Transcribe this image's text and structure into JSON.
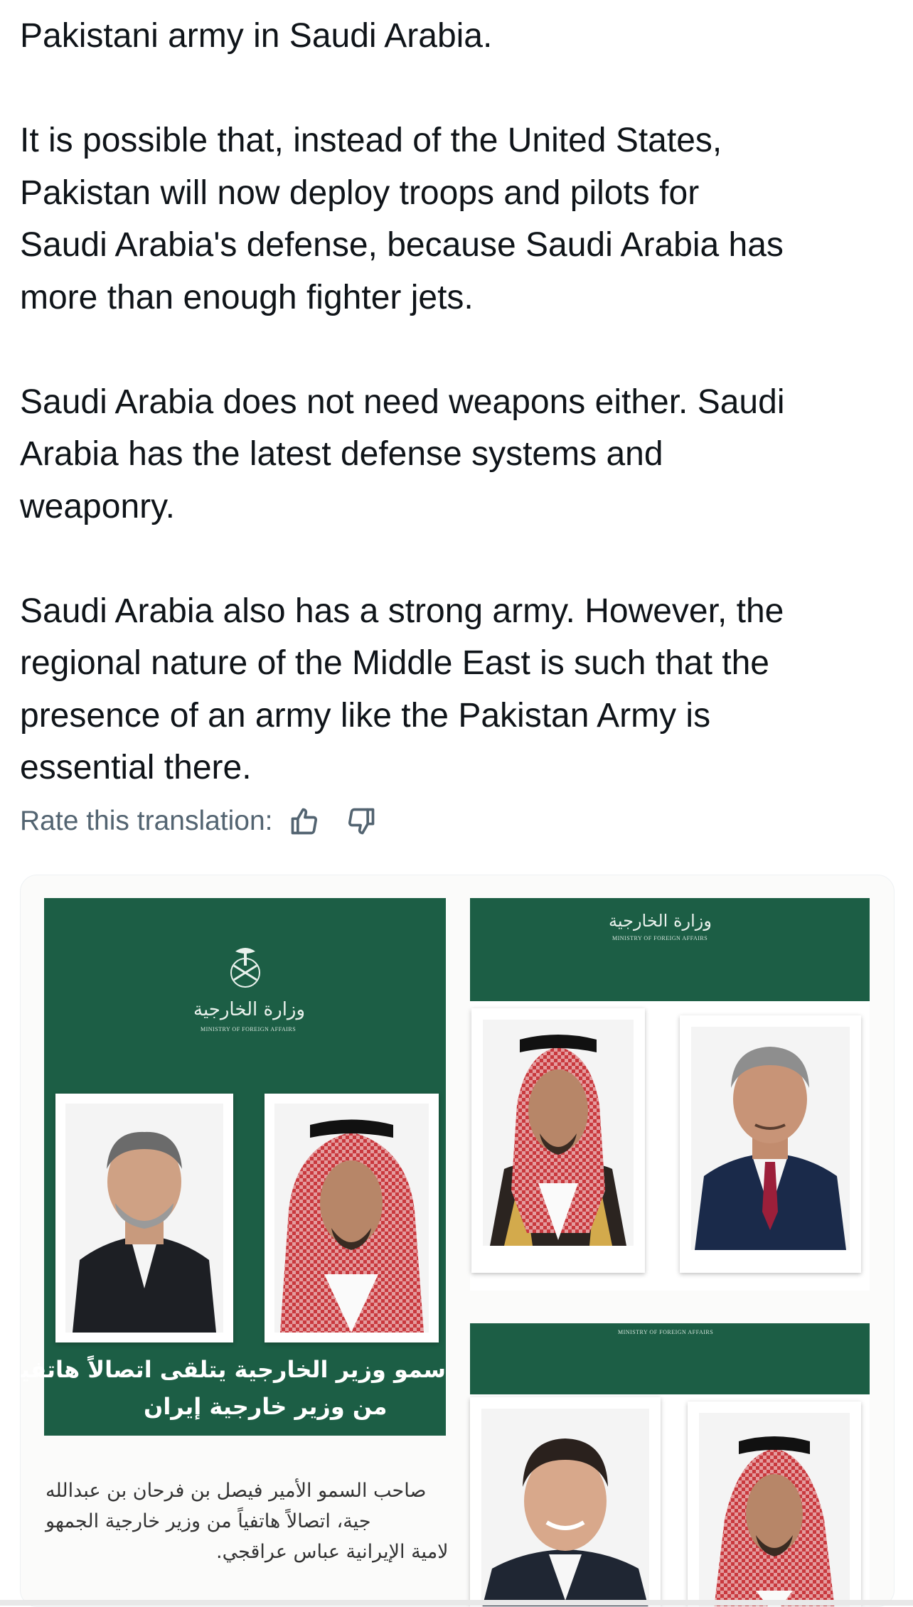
{
  "tweet": {
    "paragraphs": [
      "Pakistani army in Saudi Arabia.",
      "It is possible that, instead of the United States,\nPakistan will now deploy troops and pilots for\nSaudi Arabia's defense, because Saudi Arabia has\nmore than enough fighter jets.",
      "Saudi Arabia does not need weapons either. Saudi\nArabia has the latest defense systems and\nweaponry.",
      "Saudi Arabia also has a strong army. However, the\nregional nature of the Middle East is such that the\npresence of an army like the Pakistan Army is\nessential there."
    ]
  },
  "translation_rating": {
    "label": "Rate this translation:",
    "like_icon": "thumbs-up-icon",
    "dislike_icon": "thumbs-down-icon"
  },
  "media": {
    "left_graphic": {
      "ministry_ar": "وزارة الخارجية",
      "ministry_en": "MINISTRY OF FOREIGN AFFAIRS",
      "headline_line1": "سمو وزير الخارجية يتلقى اتصالاً هاتفياً",
      "headline_line2": "من وزير خارجية إيران",
      "body_line1": "صاحب السمو الأمير فيصل بن فرحان بن عبدالله",
      "body_line2": "جية، اتصالاً هاتفياً من وزير خارجية الجمهو",
      "body_line3": "لامية الإيرانية عباس عراقجي."
    },
    "top_right_graphic": {
      "ministry_ar": "وزارة الخارجية",
      "ministry_en": "MINISTRY OF FOREIGN AFFAIRS"
    },
    "bottom_right_graphic": {
      "ministry_en": "MINISTRY OF FOREIGN AFFAIRS"
    },
    "colors": {
      "ministry_green": "#1c5e45",
      "text_dark": "#0f1419",
      "muted": "#536471"
    }
  }
}
